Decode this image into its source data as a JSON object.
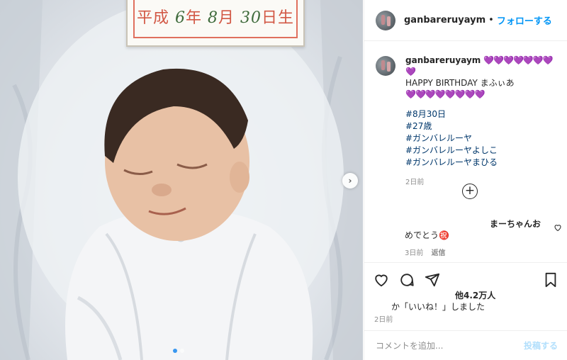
{
  "photo": {
    "name_card_prefix": "平成",
    "name_card_year": "6",
    "name_card_year_unit": "年",
    "name_card_month": "8",
    "name_card_month_unit": "月",
    "name_card_day": "30",
    "name_card_day_unit": "日生",
    "carousel_next_glyph": "›",
    "carousel_dots_total": 2,
    "carousel_dot_active": 1
  },
  "header": {
    "username": "ganbareruyaym",
    "separator": "•",
    "follow_label": "フォローする"
  },
  "caption": {
    "username": "ganbareruyaym",
    "hearts_line1": "💜💜💜💜💜💜💜💜",
    "text": "HAPPY BIRTHDAY まふぃあ",
    "hearts_line2": "💜💜💜💜💜💜💜💜",
    "hashtags": [
      "#8月30日",
      "#27歳",
      "#ガンバレルーヤ",
      "#ガンバレルーヤよしこ",
      "#ガンバレルーヤまひる"
    ],
    "time": "2日前"
  },
  "comment": {
    "username": "まーちゃんお",
    "text": "めでとう㊗️",
    "time": "3日前",
    "reply_label": "返信"
  },
  "icons": {
    "heart": "heart-icon",
    "comment": "comment-icon",
    "share": "paper-plane-icon",
    "bookmark": "bookmark-icon",
    "load_more": "plus-circle-icon",
    "comment_like": "heart-outline-icon"
  },
  "likes": {
    "count": "他4.2万人",
    "text": "か「いいね！」しました"
  },
  "post_time": "2日前",
  "comment_box": {
    "placeholder": "コメントを追加...",
    "post_label": "投稿する"
  },
  "colors": {
    "follow_blue": "#0095f6",
    "hashtag_blue": "#00376b",
    "muted_gray": "#8e8e8e",
    "post_disabled": "#b2dffc"
  }
}
